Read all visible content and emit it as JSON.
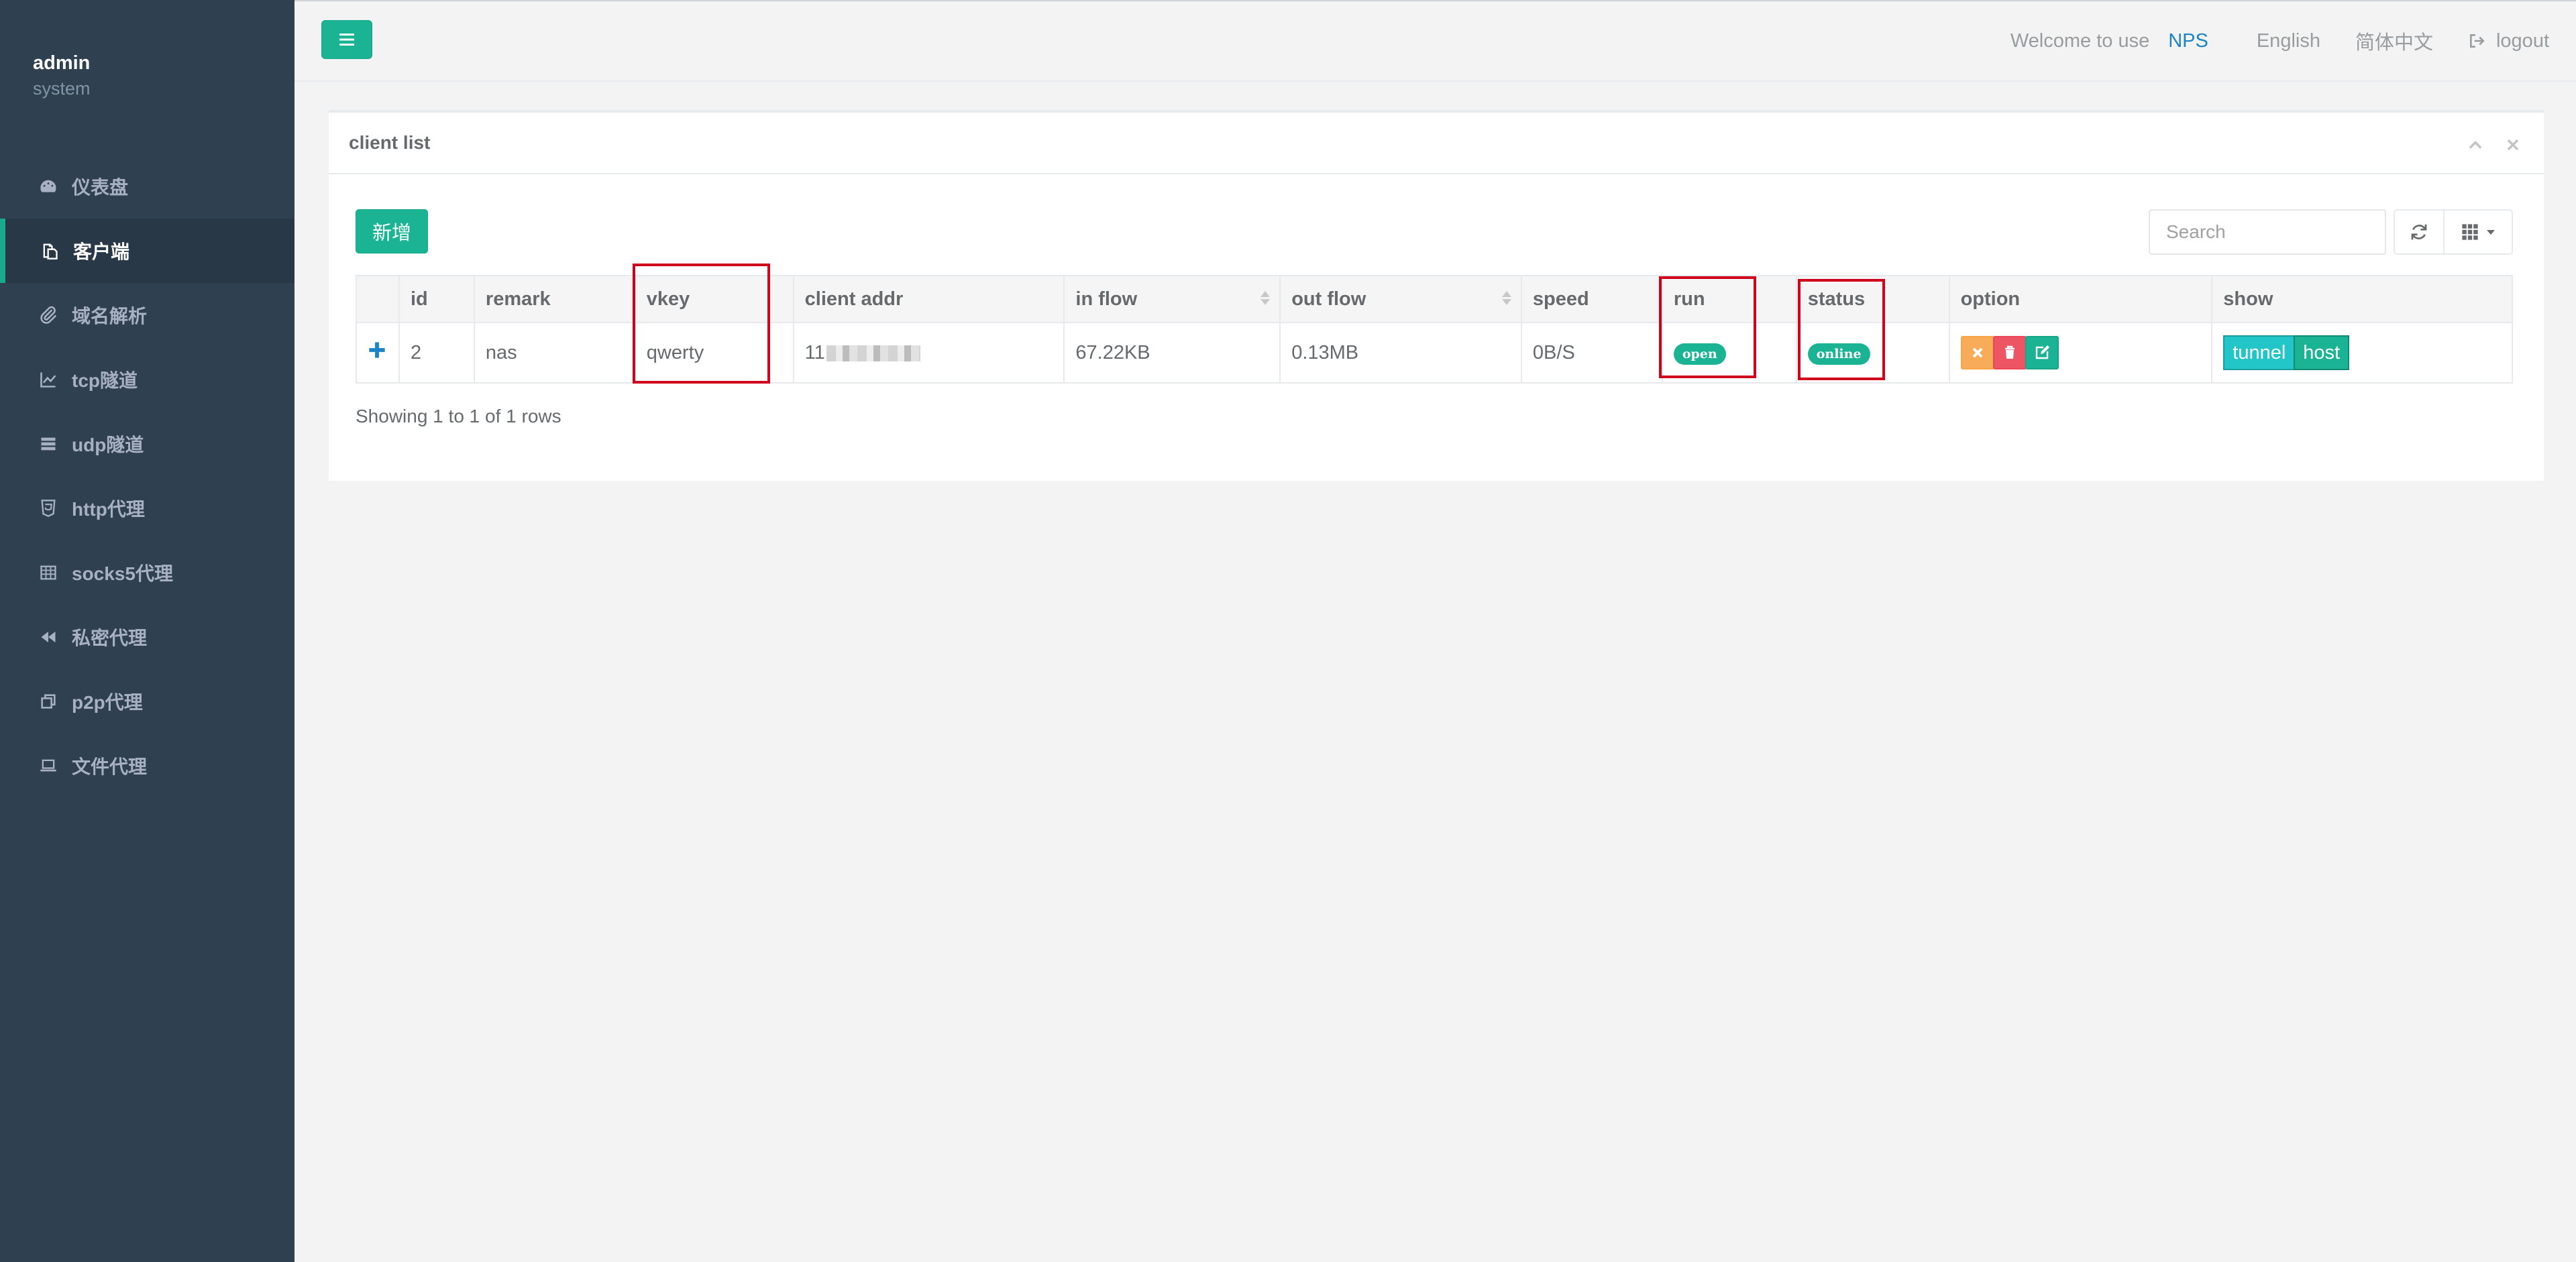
{
  "sidebar": {
    "user": "admin",
    "role": "system",
    "items": [
      {
        "label": "仪表盘",
        "icon": "dashboard-icon"
      },
      {
        "label": "客户端",
        "icon": "clients-icon",
        "active": true
      },
      {
        "label": "域名解析",
        "icon": "paperclip-icon"
      },
      {
        "label": "tcp隧道",
        "icon": "line-chart-icon"
      },
      {
        "label": "udp隧道",
        "icon": "server-icon"
      },
      {
        "label": "http代理",
        "icon": "html5-icon"
      },
      {
        "label": "socks5代理",
        "icon": "table-icon"
      },
      {
        "label": "私密代理",
        "icon": "backward-icon"
      },
      {
        "label": "p2p代理",
        "icon": "clone-icon"
      },
      {
        "label": "文件代理",
        "icon": "laptop-icon"
      }
    ]
  },
  "topbar": {
    "welcome": "Welcome to use",
    "brand": "NPS",
    "lang_en": "English",
    "lang_zh": "简体中文",
    "logout": "logout"
  },
  "panel": {
    "title": "client list",
    "add_label": "新增",
    "search_placeholder": "Search",
    "columns": [
      "id",
      "remark",
      "vkey",
      "client addr",
      "in flow",
      "out flow",
      "speed",
      "run",
      "status",
      "option",
      "show"
    ],
    "rows": [
      {
        "id": "2",
        "remark": "nas",
        "vkey": "qwerty",
        "client_addr_prefix": "11",
        "in_flow": "67.22KB",
        "out_flow": "0.13MB",
        "speed": "0B/S",
        "run": "open",
        "status": "online",
        "show_tunnel": "tunnel",
        "show_host": "host"
      }
    ],
    "pagination": "Showing 1 to 1 of 1 rows"
  },
  "colors": {
    "sidebar_bg": "#2f4050",
    "accent": "#1ab394",
    "highlight": "#d0021b",
    "warning": "#f8ac59",
    "danger": "#ed5565",
    "info": "#23c6c8"
  }
}
